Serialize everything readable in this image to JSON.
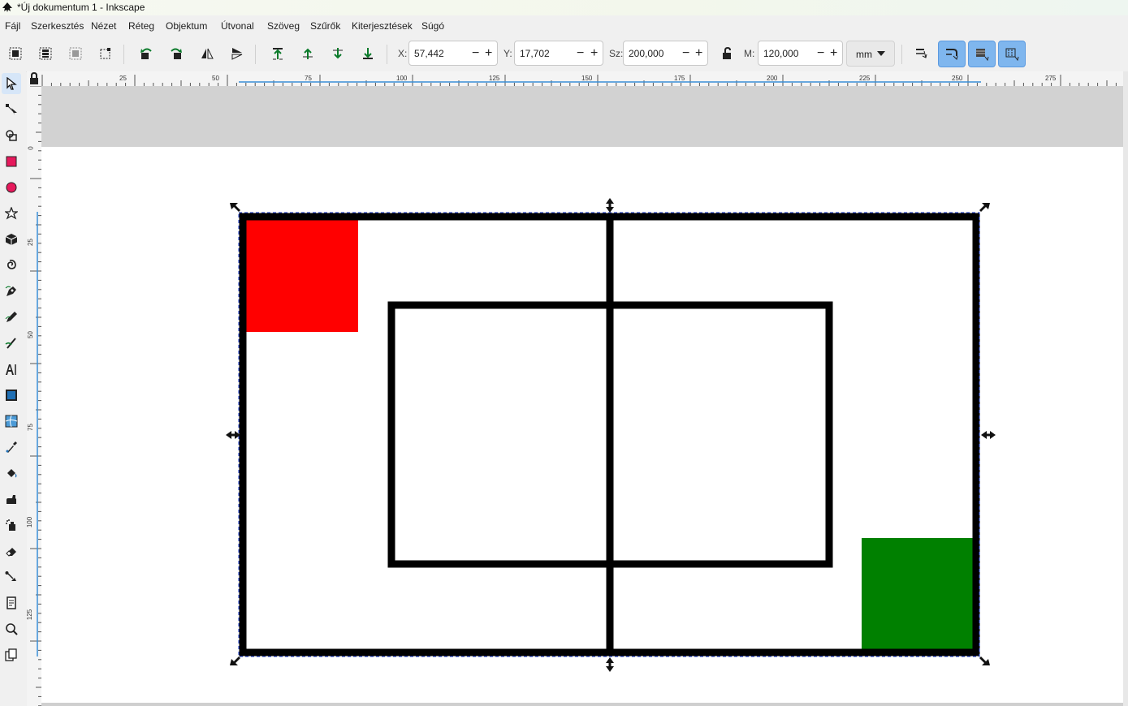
{
  "window": {
    "title": "*Új dokumentum 1 - Inkscape"
  },
  "menu": [
    "Fájl",
    "Szerkesztés",
    "Nézet",
    "Réteg",
    "Objektum",
    "Útvonal",
    "Szöveg",
    "Szűrők",
    "Kiterjesztések",
    "Súgó"
  ],
  "toolbar": {
    "x_label": "X:",
    "x_value": "57,442",
    "y_label": "Y:",
    "y_value": "17,702",
    "w_label": "Sz:",
    "w_value": "200,000",
    "h_label": "M:",
    "h_value": "120,000",
    "unit": "mm"
  },
  "ruler": {
    "h_labels": [
      "25",
      "50",
      "75",
      "100",
      "125",
      "150",
      "175",
      "200",
      "225",
      "250",
      "275"
    ],
    "v_labels": [
      "0",
      "25",
      "50",
      "75",
      "100",
      "125"
    ]
  },
  "colors": {
    "red": "#ff0000",
    "green": "#008000",
    "stroke": "#000000",
    "accent": "#7fb6ee"
  },
  "tools": [
    "selector-tool",
    "node-tool",
    "shape-builder-tool",
    "rectangle-tool",
    "ellipse-tool",
    "star-tool",
    "3d-box-tool",
    "spiral-tool",
    "pen-tool",
    "pencil-tool",
    "calligraphy-tool",
    "text-tool",
    "gradient-tool",
    "mesh-tool",
    "dropper-tool",
    "paint-bucket-tool",
    "tweak-tool",
    "spray-tool",
    "eraser-tool",
    "connector-tool",
    "pages-tool",
    "zoom-tool",
    "measure-tool"
  ]
}
